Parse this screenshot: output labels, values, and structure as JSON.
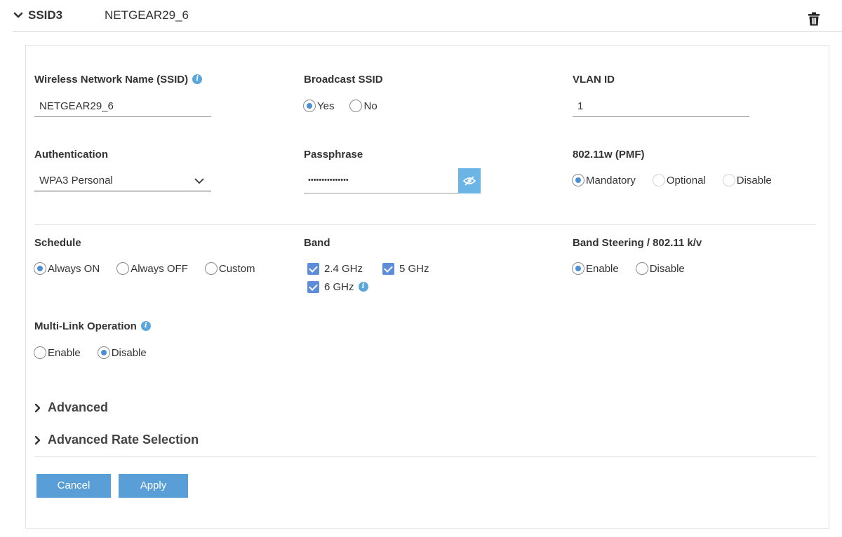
{
  "header": {
    "ssid_label": "SSID3",
    "ssid_name": "NETGEAR29_6"
  },
  "fields": {
    "ssid": {
      "label": "Wireless Network Name (SSID)",
      "value": "NETGEAR29_6"
    },
    "broadcast": {
      "label": "Broadcast SSID",
      "options": [
        "Yes",
        "No"
      ],
      "selected": "Yes"
    },
    "vlan": {
      "label": "VLAN ID",
      "value": "1"
    },
    "authentication": {
      "label": "Authentication",
      "value": "WPA3 Personal"
    },
    "passphrase": {
      "label": "Passphrase",
      "value": "•••••••••••••••"
    },
    "pmf": {
      "label": "802.11w (PMF)",
      "options": [
        "Mandatory",
        "Optional",
        "Disable"
      ],
      "selected": "Mandatory"
    },
    "schedule": {
      "label": "Schedule",
      "options": [
        "Always ON",
        "Always OFF",
        "Custom"
      ],
      "selected": "Always ON"
    },
    "band": {
      "label": "Band",
      "options": [
        "2.4 GHz",
        "5 GHz",
        "6 GHz"
      ],
      "checked": [
        "2.4 GHz",
        "5 GHz",
        "6 GHz"
      ]
    },
    "band_steering": {
      "label": "Band Steering / 802.11 k/v",
      "options": [
        "Enable",
        "Disable"
      ],
      "selected": "Enable"
    },
    "mlo": {
      "label": "Multi-Link Operation",
      "options": [
        "Enable",
        "Disable"
      ],
      "selected": "Disable"
    }
  },
  "sections": {
    "advanced": "Advanced",
    "advanced_rate": "Advanced Rate Selection"
  },
  "buttons": {
    "cancel": "Cancel",
    "apply": "Apply"
  },
  "colors": {
    "accent": "#5a9ed7",
    "radio_dot": "#4b8fd6",
    "eye_button": "#6bb5e6"
  }
}
